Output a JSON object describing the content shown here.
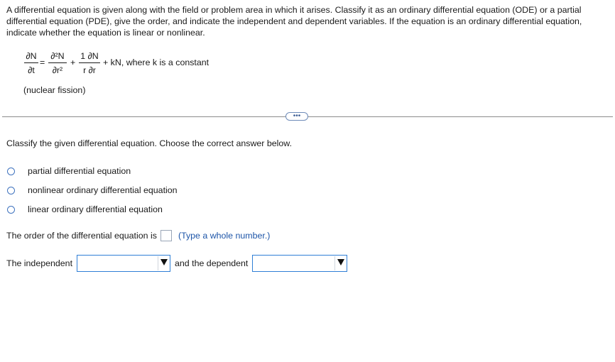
{
  "prompt": "A differential equation is given along with the field or problem area in which it arises. Classify it as an ordinary differential equation (ODE) or a partial differential equation (PDE), give the order, and indicate the independent and dependent variables. If the equation is an ordinary differential equation, indicate whether the equation is linear or nonlinear.",
  "equation": {
    "lhs_num": "∂N",
    "lhs_den": "∂t",
    "eq": "=",
    "t1_num": "∂²N",
    "t1_den": "∂r²",
    "plus": "+",
    "t2_num": "1 ∂N",
    "t2_den": "r ∂r",
    "tail": "+ kN, where k is a constant"
  },
  "field": "(nuclear fission)",
  "more_button": "•••",
  "question": "Classify the given differential equation. Choose the correct answer below.",
  "options": [
    "partial differential equation",
    "nonlinear ordinary differential equation",
    "linear ordinary differential equation"
  ],
  "order": {
    "label": "The order of the differential equation is",
    "value": "",
    "hint": "(Type a whole number.)"
  },
  "variables": {
    "independent_label": "The independent",
    "independent_value": "",
    "dependent_label": "and the dependent",
    "dependent_value": ""
  }
}
